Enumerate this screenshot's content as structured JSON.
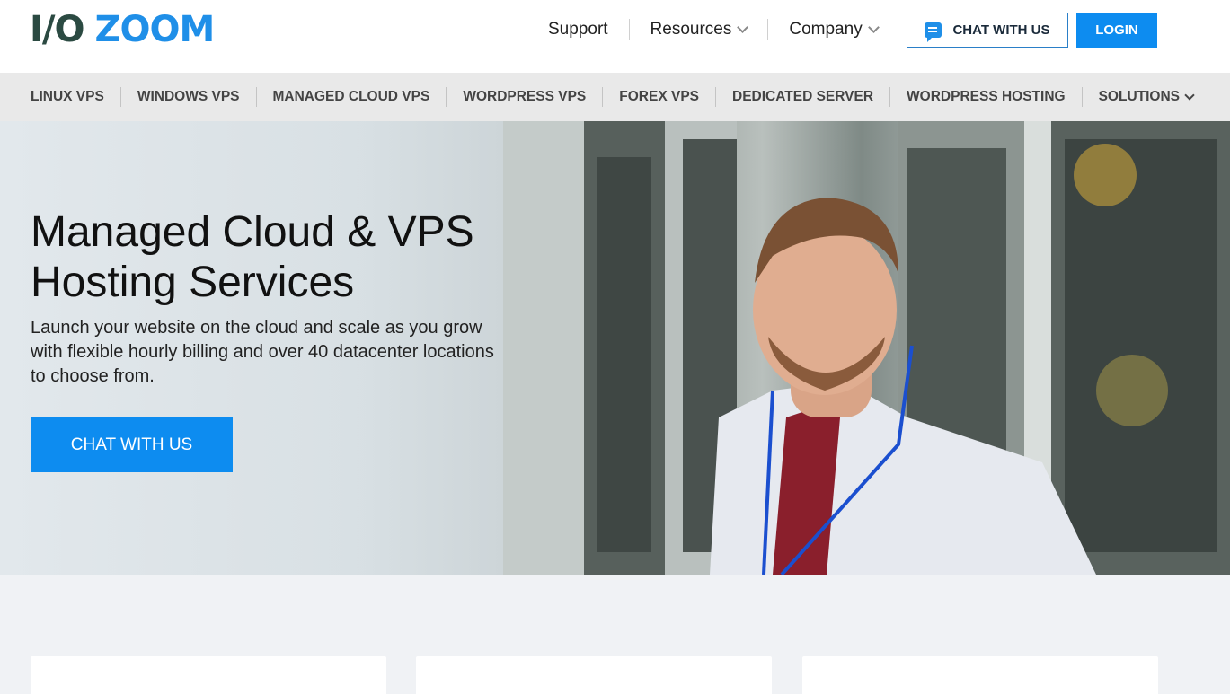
{
  "header": {
    "logo_part1": "I/O",
    "logo_part2": "ZOOM",
    "nav": [
      {
        "label": "Support",
        "has_dropdown": false
      },
      {
        "label": "Resources",
        "has_dropdown": true
      },
      {
        "label": "Company",
        "has_dropdown": true
      }
    ],
    "chat_button": "CHAT WITH US",
    "login_button": "LOGIN"
  },
  "subnav": {
    "items": [
      "LINUX VPS",
      "WINDOWS VPS",
      "MANAGED CLOUD VPS",
      "WORDPRESS VPS",
      "FOREX VPS",
      "DEDICATED SERVER",
      "WORDPRESS HOSTING",
      "SOLUTIONS"
    ]
  },
  "hero": {
    "title_line1": "Managed Cloud & VPS",
    "title_line2": "Hosting Services",
    "subtitle": "Launch your website on the cloud and scale as you grow with flexible hourly billing and over 40 datacenter locations to choose from.",
    "cta": "CHAT WITH US"
  },
  "colors": {
    "accent": "#0d8cf0",
    "logo_dark": "#2b4a42",
    "logo_blue": "#1f8fe8"
  },
  "icons": {
    "chat": "chat-bubble-icon",
    "dropdown": "chevron-down-icon"
  }
}
